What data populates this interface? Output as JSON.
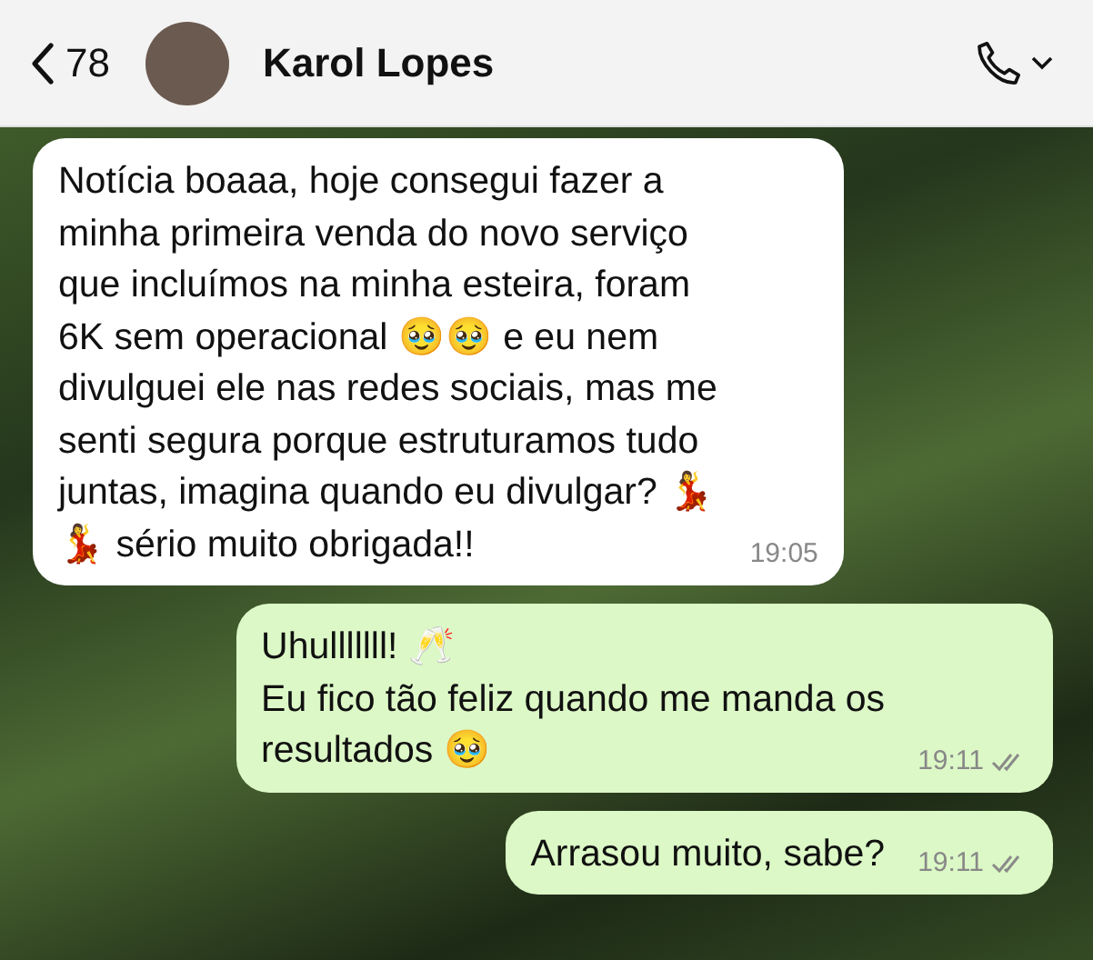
{
  "header": {
    "back_count": "78",
    "contact_name": "Karol Lopes"
  },
  "messages": [
    {
      "kind": "incoming",
      "text": "Notícia boaaa, hoje consegui fazer a\nminha primeira venda do novo serviço\nque incluímos na minha esteira, foram\n6K sem operacional 🥹🥹 e eu nem\ndivulguei ele nas redes sociais, mas me\nsenti segura porque estruturamos tudo\njuntas, imagina quando eu divulgar? 💃\n💃 sério muito obrigada!!",
      "time": "19:05",
      "read": false
    },
    {
      "kind": "outgoing",
      "text": "Uhulllllll! 🥂\nEu fico tão feliz quando me manda os\nresultados 🥹",
      "time": "19:11",
      "read": true
    },
    {
      "kind": "outgoing",
      "text": "Arrasou muito, sabe?",
      "time": "19:11",
      "read": true
    }
  ]
}
